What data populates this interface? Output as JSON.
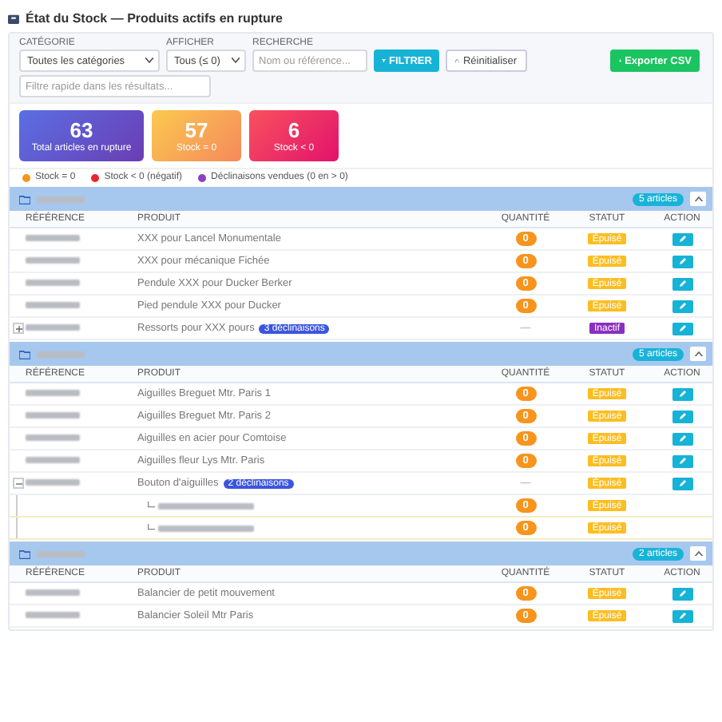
{
  "title": "État du Stock — Produits actifs en rupture",
  "filters": {
    "category": {
      "label": "CATÉGORIE",
      "value": "Toutes les catégories"
    },
    "show": {
      "label": "AFFICHER",
      "value": "Tous (≤ 0)"
    },
    "search": {
      "label": "RECHERCHE",
      "placeholder": "Nom ou référence..."
    },
    "filter_button": "FILTRER",
    "reset_button": "Réinitialiser",
    "export_button": "Exporter CSV",
    "quick_search": {
      "placeholder": "Filtre rapide dans les résultats..."
    }
  },
  "stats": [
    {
      "value": "63",
      "label": "Total articles en rupture",
      "kind": "total"
    },
    {
      "value": "57",
      "label": "Stock = 0",
      "kind": "zero"
    },
    {
      "value": "6",
      "label": "Stock < 0",
      "kind": "negative"
    }
  ],
  "legend": [
    {
      "label": "Stock = 0",
      "color": "#f7941d"
    },
    {
      "label": "Stock < 0 (négatif)",
      "color": "#e8262d"
    },
    {
      "label": "Déclinaisons vendues (0 en > 0)",
      "color": "#8e3fc1"
    }
  ],
  "groups": [
    {
      "count": "5 articles",
      "expanded": true,
      "columns": [
        "RÉFÉRENCE",
        "PRODUIT",
        "QUANTITÉ",
        "STATUT",
        "ACTION"
      ],
      "rows": [
        {
          "product": "XXX pour Lancel Monumentale",
          "kind": "zero",
          "quantity": "0",
          "status": {
            "label": "Épuisé",
            "kind": "sold_out"
          }
        },
        {
          "product": "XXX pour mécanique Fichée",
          "kind": "zero",
          "quantity": "0",
          "status": {
            "label": "Épuisé",
            "kind": "sold_out"
          }
        },
        {
          "product": "Pendule XXX pour Ducker Berker",
          "kind": "zero",
          "quantity": "0",
          "status": {
            "label": "Épuisé",
            "kind": "sold_out"
          }
        },
        {
          "product": "Pied pendule XXX pour Ducker",
          "kind": "zero",
          "quantity": "0",
          "status": {
            "label": "Épuisé",
            "kind": "sold_out"
          }
        },
        {
          "product": "Ressorts pour XXX pours",
          "variants": "3 déclinaisons",
          "expanded": false,
          "kind": "none",
          "quantity": "—",
          "status": {
            "label": "Inactif",
            "kind": "inactive"
          }
        }
      ]
    },
    {
      "count": "5 articles",
      "expanded": true,
      "columns": [
        "RÉFÉRENCE",
        "PRODUIT",
        "QUANTITÉ",
        "STATUT",
        "ACTION"
      ],
      "rows": [
        {
          "product": "Aiguilles Breguet Mtr. Paris 1",
          "kind": "zero",
          "quantity": "0",
          "status": {
            "label": "Épuisé",
            "kind": "sold_out"
          }
        },
        {
          "product": "Aiguilles Breguet Mtr. Paris 2",
          "kind": "zero",
          "quantity": "0",
          "status": {
            "label": "Épuisé",
            "kind": "sold_out"
          }
        },
        {
          "product": "Aiguilles en acier pour Comtoise",
          "kind": "zero",
          "quantity": "0",
          "status": {
            "label": "Épuisé",
            "kind": "sold_out"
          }
        },
        {
          "product": "Aiguilles fleur Lys Mtr. Paris",
          "kind": "zero",
          "quantity": "0",
          "status": {
            "label": "Épuisé",
            "kind": "sold_out"
          }
        },
        {
          "product": "Bouton d'aiguilles",
          "variants": "2 déclinaisons",
          "expanded": true,
          "kind": "none",
          "quantity": "—",
          "status": {
            "label": "Épuisé",
            "kind": "sold_out"
          },
          "children": [
            {
              "kind": "zero",
              "quantity": "0",
              "status": {
                "label": "Épuisé",
                "kind": "sold_out"
              }
            },
            {
              "kind": "zero",
              "quantity": "0",
              "status": {
                "label": "Épuisé",
                "kind": "sold_out"
              }
            }
          ]
        }
      ]
    },
    {
      "count": "2 articles",
      "expanded": true,
      "columns": [
        "RÉFÉRENCE",
        "PRODUIT",
        "QUANTITÉ",
        "STATUT",
        "ACTION"
      ],
      "rows": [
        {
          "product": "Balancier de petit mouvement",
          "kind": "zero",
          "quantity": "0",
          "status": {
            "label": "Épuisé",
            "kind": "sold_out"
          }
        },
        {
          "product": "Balancier Soleil Mtr Paris",
          "kind": "zero",
          "quantity": "0",
          "status": {
            "label": "Épuisé",
            "kind": "sold_out"
          }
        }
      ]
    }
  ]
}
